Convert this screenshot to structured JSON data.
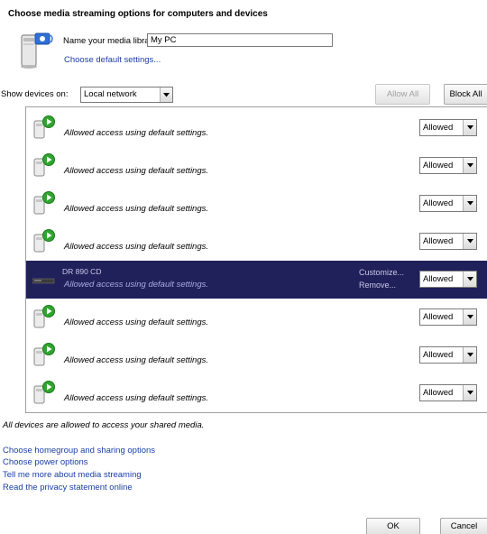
{
  "heading": "Choose media streaming options for computers and devices",
  "library": {
    "label": "Name your media library:",
    "value": "My PC",
    "default_settings_link": "Choose default settings..."
  },
  "filter": {
    "label": "Show devices on:",
    "selected": "Local network",
    "allow_all": "Allow All",
    "block_all": "Block All"
  },
  "devices": [
    {
      "status": "Allowed access using default settings.",
      "access": "Allowed",
      "selected": false
    },
    {
      "status": "Allowed access using default settings.",
      "access": "Allowed",
      "selected": false
    },
    {
      "status": "Allowed access using default settings.",
      "access": "Allowed",
      "selected": false
    },
    {
      "status": "Allowed access using default settings.",
      "access": "Allowed",
      "selected": false
    },
    {
      "name": "DR 890 CD",
      "status": "Allowed access using default settings.",
      "access": "Allowed",
      "selected": true,
      "customize_link": "Customize...",
      "remove_link": "Remove..."
    },
    {
      "status": "Allowed access using default settings.",
      "access": "Allowed",
      "selected": false
    },
    {
      "status": "Allowed access using default settings.",
      "access": "Allowed",
      "selected": false
    },
    {
      "status": "Allowed access using default settings.",
      "access": "Allowed",
      "selected": false
    }
  ],
  "footer_message": "All devices are allowed to access your shared media.",
  "links": [
    "Choose homegroup and sharing options",
    "Choose power options",
    "Tell me more about media streaming",
    "Read the privacy statement online"
  ],
  "buttons": {
    "ok": "OK",
    "cancel": "Cancel"
  },
  "colors": {
    "selection": "#20205b",
    "link": "#1a3fa8"
  },
  "icons": {
    "library": "media-library-icon",
    "device": "media-device-icon",
    "selected_device": "cd-player-icon"
  }
}
